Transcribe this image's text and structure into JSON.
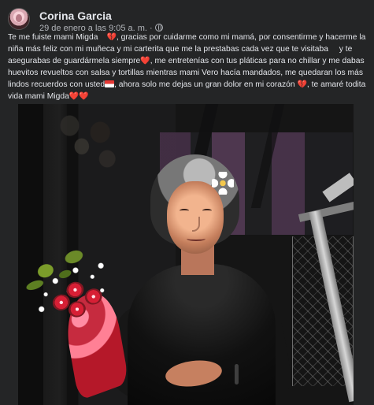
{
  "post": {
    "author": "Corina Garcia",
    "date": "29 de enero a las 9:05 a. m.",
    "separator": "·",
    "privacy_icon": "globe-icon",
    "message_lines": [
      "Te me fuiste mami Migda",
      ", gracias por cuidarme como mi mamá, por consentirme y hacerme la",
      "niña más feliz con mi muñeca y mi carterita que me la prestabas cada vez que te visitaba",
      " y te",
      "asegurabas de guardármela siempre",
      ", me entretenías con tus pláticas para no chillar y me dabas",
      "huevitos revueltos con salsa y tortillas mientras mami Vero hacía mandados, me quedaran los más",
      "lindos recuerdos con usted",
      ", ahora solo me dejas un gran dolor en mi corazón ",
      ", te amaré todita la",
      "vida mami Migda"
    ],
    "emojis": {
      "crying_face": "😭",
      "broken_heart": "💔",
      "smiling_face": "🥹",
      "red_heart": "❤️",
      "flag": "🇨🇱"
    },
    "photo": {
      "alt_subjects": [
        "woman",
        "bouquet",
        "flower",
        "railing"
      ]
    }
  }
}
